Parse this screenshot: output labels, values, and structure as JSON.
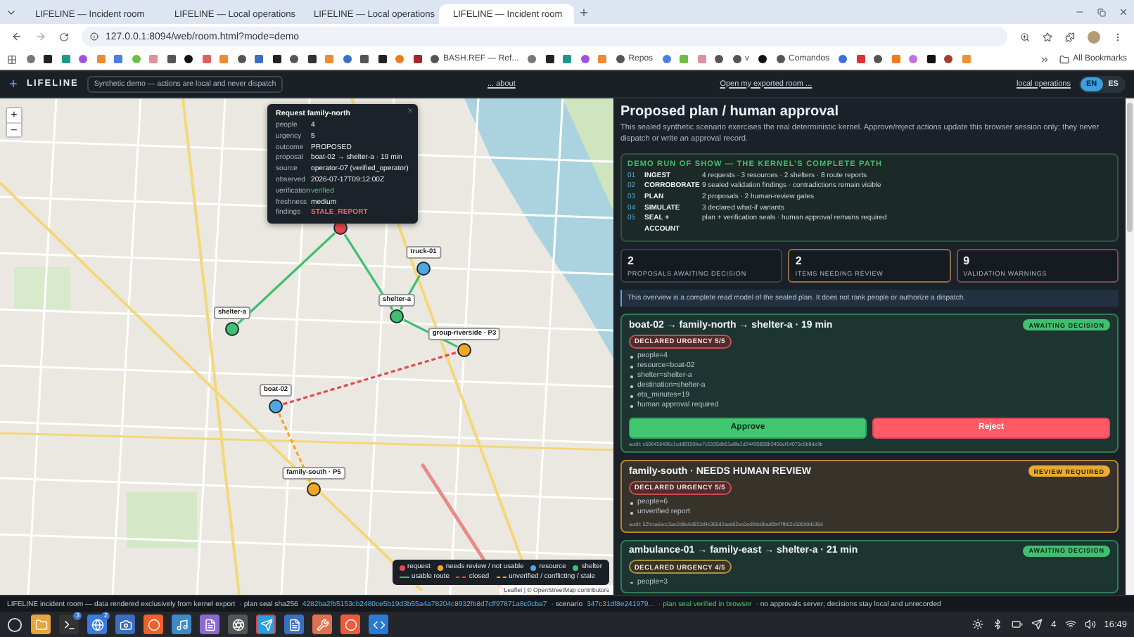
{
  "browser": {
    "tabs": [
      {
        "title": "LIFELINE — Incident room",
        "selected": false
      },
      {
        "title": "LIFELINE — Local operations",
        "selected": false
      },
      {
        "title": "LIFELINE — Local operations",
        "selected": false
      },
      {
        "title": "LIFELINE — Incident room",
        "selected": true
      }
    ],
    "url": "127.0.0.1:8094/web/room.html?mode=demo",
    "bookmarks": [
      {
        "label": "BASH.REF — Ref..."
      },
      {
        "label": "Repos"
      },
      {
        "label": "v"
      },
      {
        "label": "Comandos"
      }
    ],
    "all_bookmarks": "All Bookmarks"
  },
  "header": {
    "logo": "LIFELINE",
    "demo_badge": "Synthetic demo — actions are local and never dispatch",
    "about_link": "... about",
    "export_link": "Open my exported room ...",
    "ops_link": "local operations",
    "languages": [
      {
        "code": "EN",
        "selected": true
      },
      {
        "code": "ES",
        "selected": false
      }
    ]
  },
  "map": {
    "zoom_in": "+",
    "zoom_out": "−",
    "nodes": [
      {
        "kind": "request"
      },
      {
        "kind": "resource",
        "label": "truck-01"
      },
      {
        "kind": "shelter",
        "label": "shelter-a"
      },
      {
        "kind": "shelter",
        "label": "shelter-a"
      },
      {
        "kind": "review",
        "label": "group-riverside · P3"
      },
      {
        "kind": "resource",
        "label": "boat-02"
      },
      {
        "kind": "review",
        "label": "family-south · P5"
      }
    ],
    "routes": [
      {
        "kind": "usable"
      },
      {
        "kind": "usable"
      },
      {
        "kind": "usable"
      },
      {
        "kind": "usable"
      },
      {
        "kind": "closed"
      },
      {
        "kind": "unverified"
      }
    ],
    "popup": {
      "title": "Request family-north",
      "fields": [
        {
          "key": "people",
          "value": "4",
          "kind": "plain"
        },
        {
          "key": "urgency",
          "value": "5",
          "kind": "plain"
        },
        {
          "key": "outcome",
          "value": "PROPOSED",
          "kind": "plain"
        },
        {
          "key": "proposal",
          "value": "boat-02 → shelter-a · 19 min",
          "kind": "plain"
        },
        {
          "key": "source",
          "value": "operator-07 (verified_operator)",
          "kind": "plain"
        },
        {
          "key": "observed",
          "value": "2026-07-17T09:12:00Z",
          "kind": "plain"
        },
        {
          "key": "verification",
          "value": "verified",
          "kind": "good"
        },
        {
          "key": "freshness",
          "value": "medium",
          "kind": "plain"
        },
        {
          "key": "findings",
          "value": "STALE_REPORT",
          "kind": "bad"
        }
      ]
    },
    "legend": {
      "markers": [
        {
          "kind": "request",
          "label": "request"
        },
        {
          "kind": "review",
          "label": "needs review / not usable"
        },
        {
          "kind": "resource",
          "label": "resource"
        },
        {
          "kind": "shelter",
          "label": "shelter"
        }
      ],
      "lines": [
        {
          "kind": "usable",
          "label": "usable route"
        },
        {
          "kind": "closed",
          "label": "closed"
        },
        {
          "kind": "unverified",
          "label": "unverified / conflicting / stale"
        }
      ]
    },
    "attribution": "Leaflet | © OpenStreetMap contributors"
  },
  "panel": {
    "title": "Proposed plan / human approval",
    "description": "This sealed synthetic scenario exercises the real deterministic kernel. Approve/reject actions update this browser session only; they never dispatch or write an approval record.",
    "run_of_show": {
      "title": "DEMO RUN OF SHOW — THE KERNEL’S COMPLETE PATH",
      "steps": [
        {
          "number": "01",
          "name": "INGEST",
          "detail": "4 requests · 3 resources · 2 shelters · 8 route reports"
        },
        {
          "number": "02",
          "name": "CORROBORATE",
          "detail": "9 sealed validation findings · contradictions remain visible"
        },
        {
          "number": "03",
          "name": "PLAN",
          "detail": "2 proposals · 2 human-review gates"
        },
        {
          "number": "04",
          "name": "SIMULATE",
          "detail": "3 declared what-if variants"
        },
        {
          "number": "05",
          "name": "SEAL + ACCOUNT",
          "detail": "plan + verification seals · human approval remains required"
        }
      ]
    },
    "stats": [
      {
        "value": "2",
        "label": "PROPOSALS AWAITING DECISION",
        "kind": "neutral"
      },
      {
        "value": "2",
        "label": "ITEMS NEEDING REVIEW",
        "kind": "review"
      },
      {
        "value": "9",
        "label": "VALIDATION WARNINGS",
        "kind": "warning"
      }
    ],
    "notice": "This overview is a complete read model of the sealed plan. It does not rank people or authorize a dispatch.",
    "cards": [
      {
        "kind": "proposal",
        "title": "boat-02 → family-north → shelter-a · 19 min",
        "status": "AWAITING DECISION",
        "urgency": {
          "text": "DECLARED URGENCY 5/5",
          "kind": "high"
        },
        "items": [
          "people=4",
          "resource=boat-02",
          "shelter=shelter-a",
          "destination=shelter-a",
          "eta_minutes=19",
          "human approval required"
        ],
        "actions": [
          {
            "kind": "approve",
            "label": "Approve"
          },
          {
            "kind": "reject",
            "label": "Reject"
          }
        ],
        "audit": "audit: c606456496c1cdd8150fee7c6195db61a8fa1d24495858b3456ef14070c6b8de9b"
      },
      {
        "kind": "review",
        "title": "family-south · NEEDS HUMAN REVIEW",
        "status": "REVIEW REQUIRED",
        "urgency": {
          "text": "DECLARED URGENCY 5/5",
          "kind": "high"
        },
        "items": [
          "people=6",
          "unverified report"
        ],
        "audit": "audit: 52fcca6ecc3ae2d8e6d813d4c360d2aad62ec0ed9dc6bad0b47fb62c500d9dc36d"
      },
      {
        "kind": "proposal",
        "title": "ambulance-01 → family-east → shelter-a · 21 min",
        "status": "AWAITING DECISION",
        "urgency": {
          "text": "DECLARED URGENCY 4/5",
          "kind": "medium"
        },
        "items": [
          "people=3"
        ]
      }
    ]
  },
  "status_bar": [
    {
      "text": "LIFELINE incident room — data rendered exclusively from kernel export",
      "kind": "plain"
    },
    {
      "text": "· plan seal sha256",
      "kind": "plain"
    },
    {
      "text": "4282ba2fb5153cb2480ce5b19d3b55a4a78204c8932fb8d7cff97871a8c0cba7",
      "kind": "hash"
    },
    {
      "text": "· scenario",
      "kind": "plain"
    },
    {
      "text": "347c31df8e241979...",
      "kind": "hash"
    },
    {
      "text": "· plan seal verified in browser",
      "kind": "good"
    },
    {
      "text": "· no approvals server; decisions stay local and unrecorded",
      "kind": "plain"
    }
  ],
  "taskbar": {
    "apps": [
      {
        "kind": "folder",
        "selected": false
      },
      {
        "kind": "terminal",
        "badge": "3",
        "selected": false
      },
      {
        "kind": "browser",
        "badge": "2",
        "selected": false
      },
      {
        "kind": "camera",
        "selected": false
      },
      {
        "kind": "lion",
        "selected": false
      },
      {
        "kind": "audio",
        "selected": false
      },
      {
        "kind": "notes",
        "selected": false
      },
      {
        "kind": "aperture",
        "selected": false
      },
      {
        "kind": "telegram",
        "selected": true
      },
      {
        "kind": "document",
        "selected": false
      },
      {
        "kind": "tools",
        "selected": false
      },
      {
        "kind": "circle",
        "selected": false
      },
      {
        "kind": "code",
        "selected": false
      }
    ],
    "tray_count": "4",
    "clock": "16:49"
  }
}
